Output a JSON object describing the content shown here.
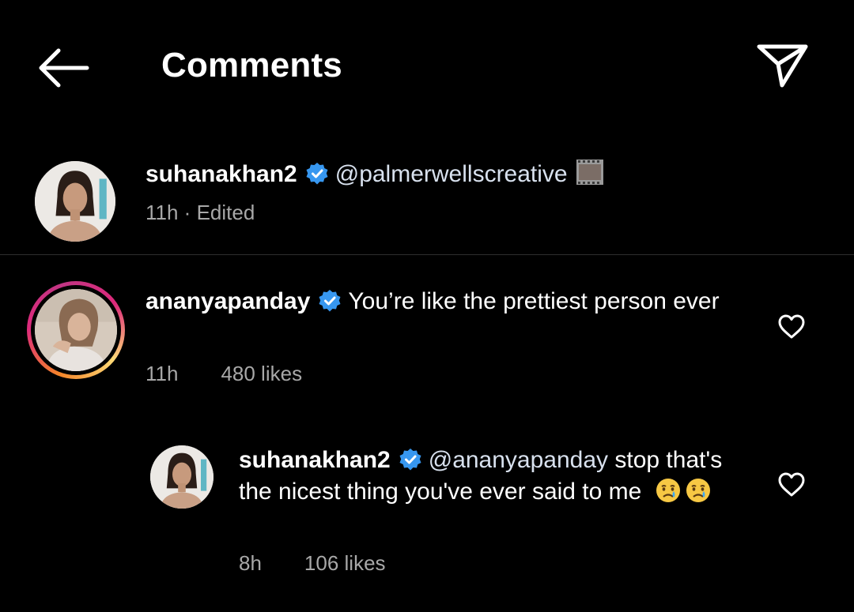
{
  "header": {
    "title": "Comments"
  },
  "caption": {
    "username": "suhanakhan2",
    "mention": "@palmerwellscreative",
    "time": "11h",
    "edited": "Edited",
    "meta_sep": " · "
  },
  "comments": [
    {
      "username": "ananyapanday",
      "text": "You’re like the prettiest person ever",
      "time": "11h",
      "likes": "480 likes",
      "has_story_ring": true
    },
    {
      "username": "suhanakhan2",
      "mention": "@ananyapanday",
      "text": " stop that's the nicest thing you've ever said to me",
      "time": "8h",
      "likes": "106 likes",
      "emojis": [
        "crying-face",
        "crying-face"
      ]
    }
  ],
  "colors": {
    "background": "#000000",
    "verified": "#3797f0",
    "meta": "#a8a8a8",
    "divider": "#2e2e2e"
  },
  "icons": {
    "back": "arrow-left-icon",
    "send": "paper-plane-icon",
    "verified": "verified-badge-icon",
    "like": "heart-outline-icon",
    "film": "film-frame-icon"
  }
}
